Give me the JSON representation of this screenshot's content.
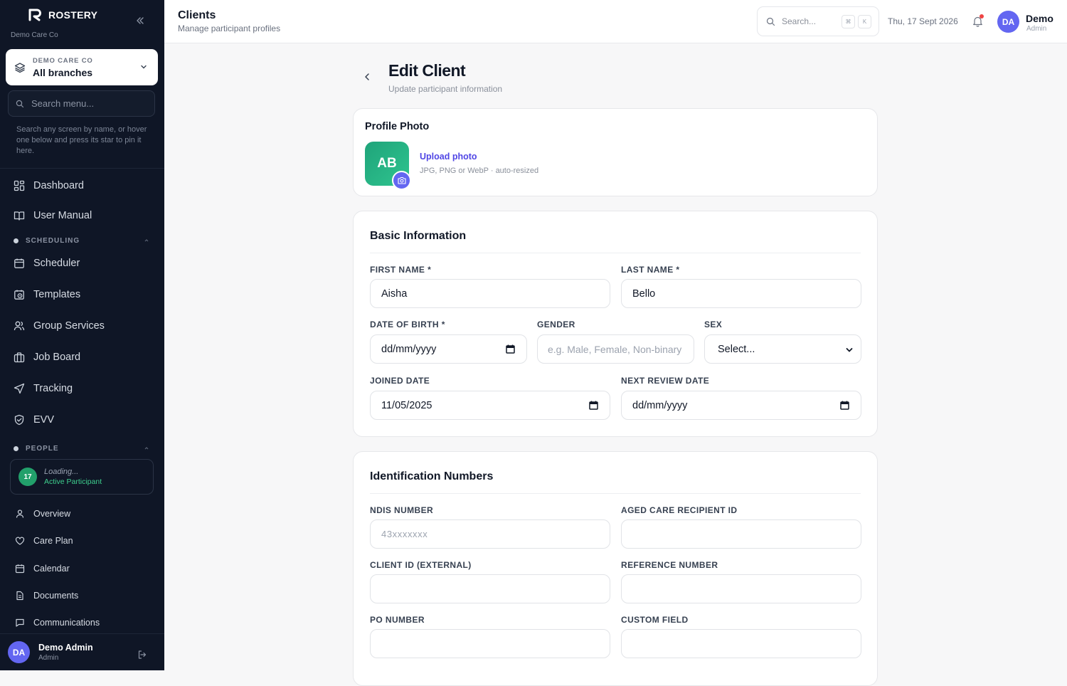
{
  "sidebar": {
    "brand": "ROSTERY",
    "org": "Demo Care Co",
    "branch_org": "DEMO CARE CO",
    "branch_value": "All branches",
    "search_placeholder": "Search menu...",
    "hint": "Search any screen by name, or hover one below and press its star to pin it here.",
    "nav_top": [
      {
        "label": "Dashboard",
        "icon": "grid-icon"
      },
      {
        "label": "User Manual",
        "icon": "book-icon"
      }
    ],
    "scheduling_section": "SCHEDULING",
    "scheduling_items": [
      {
        "label": "Scheduler",
        "icon": "calendar-icon"
      },
      {
        "label": "Templates",
        "icon": "calendar-clock-icon"
      },
      {
        "label": "Group Services",
        "icon": "users-icon"
      },
      {
        "label": "Job Board",
        "icon": "briefcase-icon"
      },
      {
        "label": "Tracking",
        "icon": "navigation-icon"
      },
      {
        "label": "EVV",
        "icon": "shield-check-icon"
      }
    ],
    "people_section": "PEOPLE",
    "participant": {
      "badge": "17",
      "name": "Loading...",
      "status": "Active Participant"
    },
    "people_items": [
      {
        "label": "Overview",
        "icon": "user-icon"
      },
      {
        "label": "Care Plan",
        "icon": "heart-icon"
      },
      {
        "label": "Calendar",
        "icon": "calendar-icon"
      },
      {
        "label": "Documents",
        "icon": "file-icon"
      },
      {
        "label": "Communications",
        "icon": "message-icon"
      }
    ],
    "user": {
      "initials": "DA",
      "name": "Demo Admin",
      "role": "Admin"
    }
  },
  "topbar": {
    "title": "Clients",
    "subtitle": "Manage participant profiles",
    "search_placeholder": "Search...",
    "kbd1": "⌘",
    "kbd2": "K",
    "date": "Thu, 17 Sept 2026",
    "user": {
      "initials": "DA",
      "name": "Demo",
      "role": "Admin"
    }
  },
  "page": {
    "title": "Edit Client",
    "subtitle": "Update participant information"
  },
  "profile_photo": {
    "title": "Profile Photo",
    "initials": "AB",
    "upload_label": "Upload photo",
    "upload_hint": "JPG, PNG or WebP · auto-resized"
  },
  "basic": {
    "title": "Basic Information",
    "first_name": {
      "label": "FIRST NAME *",
      "value": "Aisha"
    },
    "last_name": {
      "label": "LAST NAME *",
      "value": "Bello"
    },
    "dob": {
      "label": "DATE OF BIRTH *",
      "value": "dd/mm/yyyy"
    },
    "gender": {
      "label": "GENDER",
      "placeholder": "e.g. Male, Female, Non-binary"
    },
    "sex": {
      "label": "SEX",
      "value": "Select..."
    },
    "joined": {
      "label": "JOINED DATE",
      "value": "11/05/2025"
    },
    "next_review": {
      "label": "NEXT REVIEW DATE",
      "value": "dd/mm/yyyy"
    }
  },
  "ids": {
    "title": "Identification Numbers",
    "ndis": {
      "label": "NDIS NUMBER",
      "placeholder": "43xxxxxxx"
    },
    "aged_care": {
      "label": "AGED CARE RECIPIENT ID",
      "value": ""
    },
    "client_id": {
      "label": "CLIENT ID (EXTERNAL)",
      "value": ""
    },
    "reference": {
      "label": "REFERENCE NUMBER",
      "value": ""
    },
    "po": {
      "label": "PO NUMBER",
      "value": ""
    },
    "custom": {
      "label": "CUSTOM FIELD",
      "value": ""
    }
  },
  "colors": {
    "sidebar_bg": "#0f1626",
    "accent": "#6366f1",
    "brand_green": "#22a06b",
    "link": "#5046e5"
  }
}
